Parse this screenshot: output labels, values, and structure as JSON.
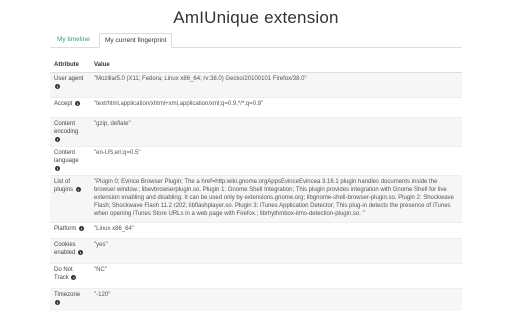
{
  "app": {
    "title": "AmIUnique extension"
  },
  "tabs": [
    {
      "label": "My timeline"
    },
    {
      "label": "My current fingerprint"
    }
  ],
  "table": {
    "headers": {
      "attribute": "Attribute",
      "value": "Value"
    },
    "rows": [
      {
        "attribute": "User agent",
        "value": "\"Mozilla/5.0 (X11; Fedora; Linux x86_64; rv:38.0) Gecko/20100101 Firefox/38.0\""
      },
      {
        "attribute": "Accept",
        "value": "\"text/html,application/xhtml+xml,application/xml;q=0.9,*/*;q=0.8\""
      },
      {
        "attribute": "Content encoding",
        "value": "\"gzip, deflate\""
      },
      {
        "attribute": "Content language",
        "value": "\"en-US,en;q=0.5\""
      },
      {
        "attribute": "List of plugins",
        "value": "\"Plugin 0: Evince Browser Plugin; The a href=http:wiki.gnome.orgAppsEvinceEvincea 3.16.1 plugin handles documents inside the browser window.; libevbrowserplugin.so. Plugin 1: Gnome Shell Integration; This plugin provides integration with Gnome Shell for live extension enabling and disabling. It can be used only by extensions.gnome.org; libgnome-shell-browser-plugin.so. Plugin 2: Shockwave Flash; Shockwave Flash 11.2 r202; libflashplayer.so. Plugin 3: iTunes Application Detector; This plug-in detects the presence of iTunes when opening iTunes Store URLs in a web page with Firefox.; librhythmbox-itms-detection-plugin.so. \""
      },
      {
        "attribute": "Platform",
        "value": "\"Linux x86_64\""
      },
      {
        "attribute": "Cookies enabled",
        "value": "\"yes\""
      },
      {
        "attribute": "Do Not Track",
        "value": "\"NC\""
      },
      {
        "attribute": "Timezone",
        "value": "\"-120\""
      }
    ]
  },
  "icons": {
    "info": "info-icon",
    "info_glyph": "i"
  }
}
